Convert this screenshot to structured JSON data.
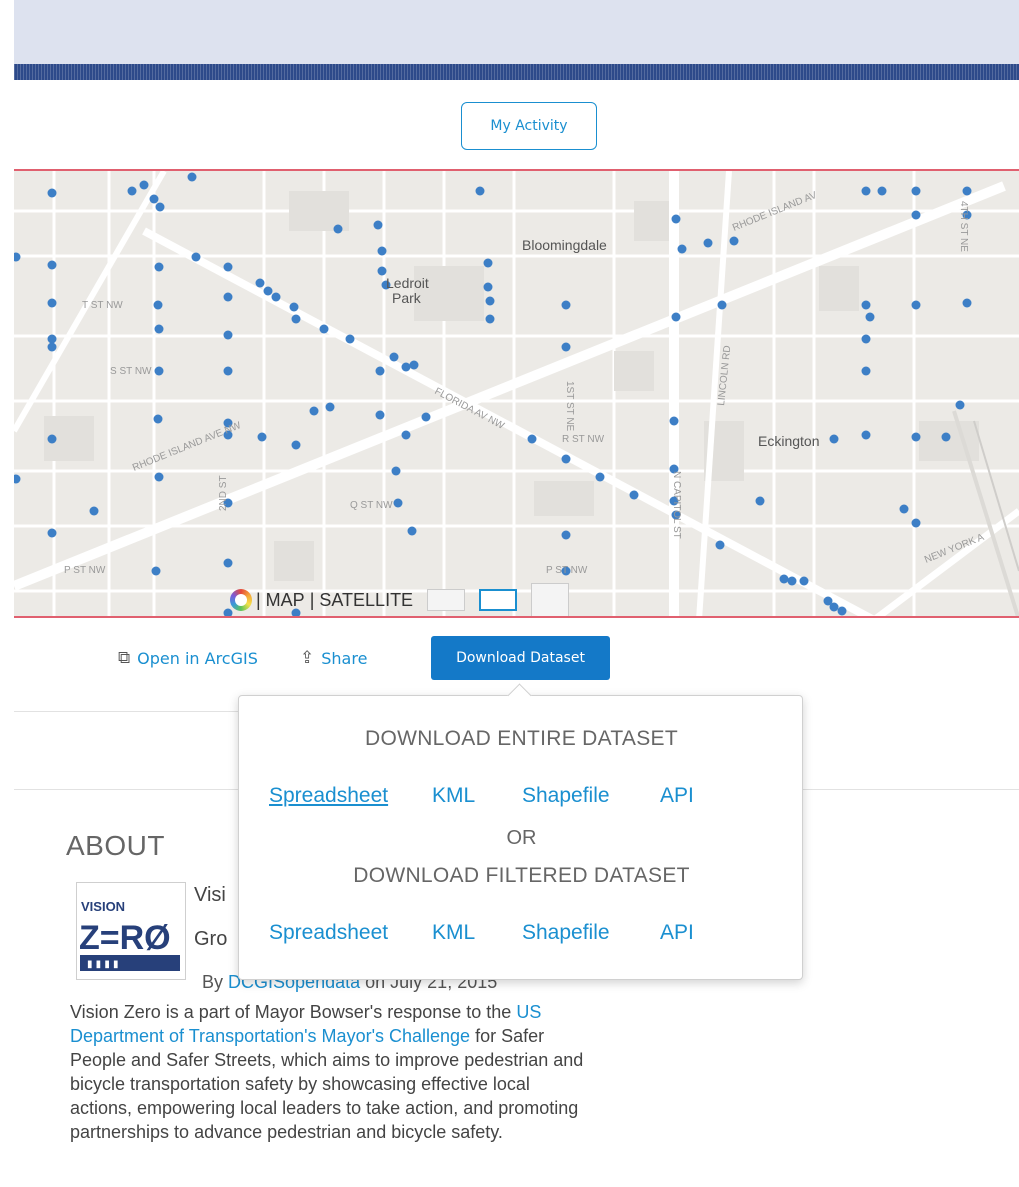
{
  "header": {
    "activity_button": "My Activity"
  },
  "map": {
    "labels": {
      "bloomingdale": "Bloomingdale",
      "ledroit1": "Ledroit",
      "ledroit2": "Park",
      "eckington": "Eckington",
      "t_st": "T ST NW",
      "s_st": "S ST NW",
      "r_st": "R ST NW",
      "q_st": "Q ST NW",
      "p_st_left": "P ST NW",
      "p_st_mid": "P ST NW",
      "rhode": "RHODE ISLAND AV",
      "florida": "FLORIDA AV NW",
      "rhode_left": "RHODE ISLAND AVE NW",
      "lincoln": "LINCOLN RD",
      "new_york": "NEW YORK A",
      "first_st": "1ST ST NE",
      "fourth_st": "4TH ST NE",
      "north_cap": "N CAPITOL ST",
      "second_st": "2ND ST"
    },
    "basemap_switch": {
      "map": "| MAP",
      "satellite": "| SATELLITE"
    },
    "dot_color": "#3d7fc6"
  },
  "actions": {
    "open_arcgis": "Open in ArcGIS",
    "share": "Share",
    "download": "Download Dataset"
  },
  "download_menu": {
    "entire_heading": "DOWNLOAD ENTIRE DATASET",
    "or": "OR",
    "filtered_heading": "DOWNLOAD FILTERED DATASET",
    "entire_options": [
      "Spreadsheet",
      "KML",
      "Shapefile",
      "API"
    ],
    "filtered_options": [
      "Spreadsheet",
      "KML",
      "Shapefile",
      "API"
    ]
  },
  "about": {
    "heading": "ABOUT",
    "title_partial": "Visi",
    "subtitle_partial": "Gro",
    "by": "By",
    "author": "DCGISopendata",
    "date_suffix": "on July 21, 2015",
    "desc_1": "Vision Zero is a part of Mayor Bowser's response to the",
    "desc_link": "US Department of Transportation's Mayor's Challenge",
    "desc_2": "for Safer People and Safer Streets, which aims to improve pedestrian and bicycle transportation safety by showcasing effective local actions, empowering local leaders to take action, and promoting partnerships to advance pedestrian and bicycle safety."
  },
  "logo": {
    "line1": "VISION",
    "line2": "Z=RØ"
  }
}
